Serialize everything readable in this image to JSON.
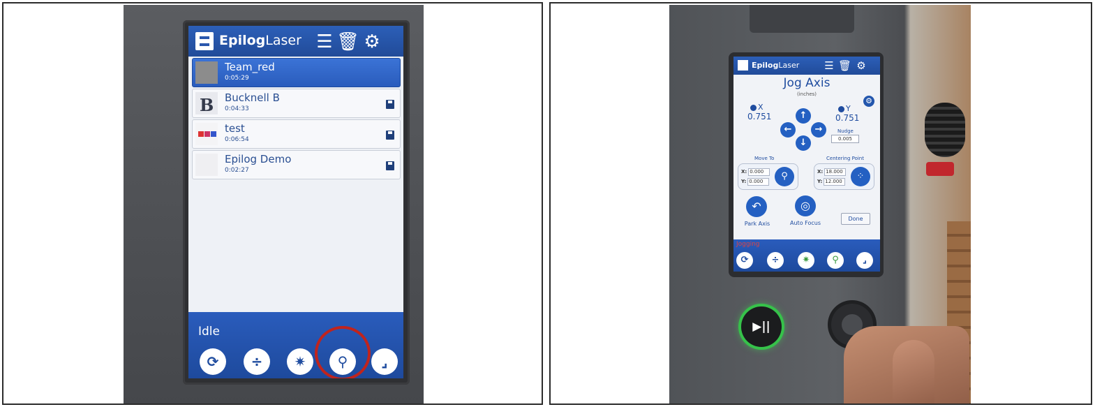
{
  "left": {
    "header": {
      "logo_bold": "Epilog",
      "logo_light": "Laser",
      "icons": [
        "list-icon",
        "trash-icon",
        "gear-icon"
      ]
    },
    "jobs": [
      {
        "name": "Team_red",
        "time": "0:05:29",
        "selected": true
      },
      {
        "name": "Bucknell B",
        "time": "0:04:33",
        "selected": false
      },
      {
        "name": "test",
        "time": "0:06:54",
        "selected": false
      },
      {
        "name": "Epilog Demo",
        "time": "0:02:27",
        "selected": false
      }
    ],
    "status": "Idle",
    "footer_buttons": [
      "refresh-icon",
      "focus-icon",
      "laser-pointer-icon",
      "jog-icon",
      "job-origin-icon"
    ],
    "highlight_color": "#c0241d"
  },
  "right": {
    "header": {
      "logo_bold": "Epilog",
      "logo_light": "Laser"
    },
    "title": "Jog Axis",
    "units": "(inches)",
    "x_label": "X",
    "x_value": "0.751",
    "y_label": "Y",
    "y_value": "0.751",
    "nudge_label": "Nudge",
    "nudge_value": "0.005",
    "move_to": {
      "label": "Move To",
      "x": "0.000",
      "y": "0.000"
    },
    "centering_point": {
      "label": "Centering Point",
      "x": "18.000",
      "y": "12.000"
    },
    "park_axis": "Park Axis",
    "auto_focus": "Auto Focus",
    "done": "Done",
    "status": "Jogging",
    "coord_prefix_x": "X:",
    "coord_prefix_y": "Y:"
  }
}
